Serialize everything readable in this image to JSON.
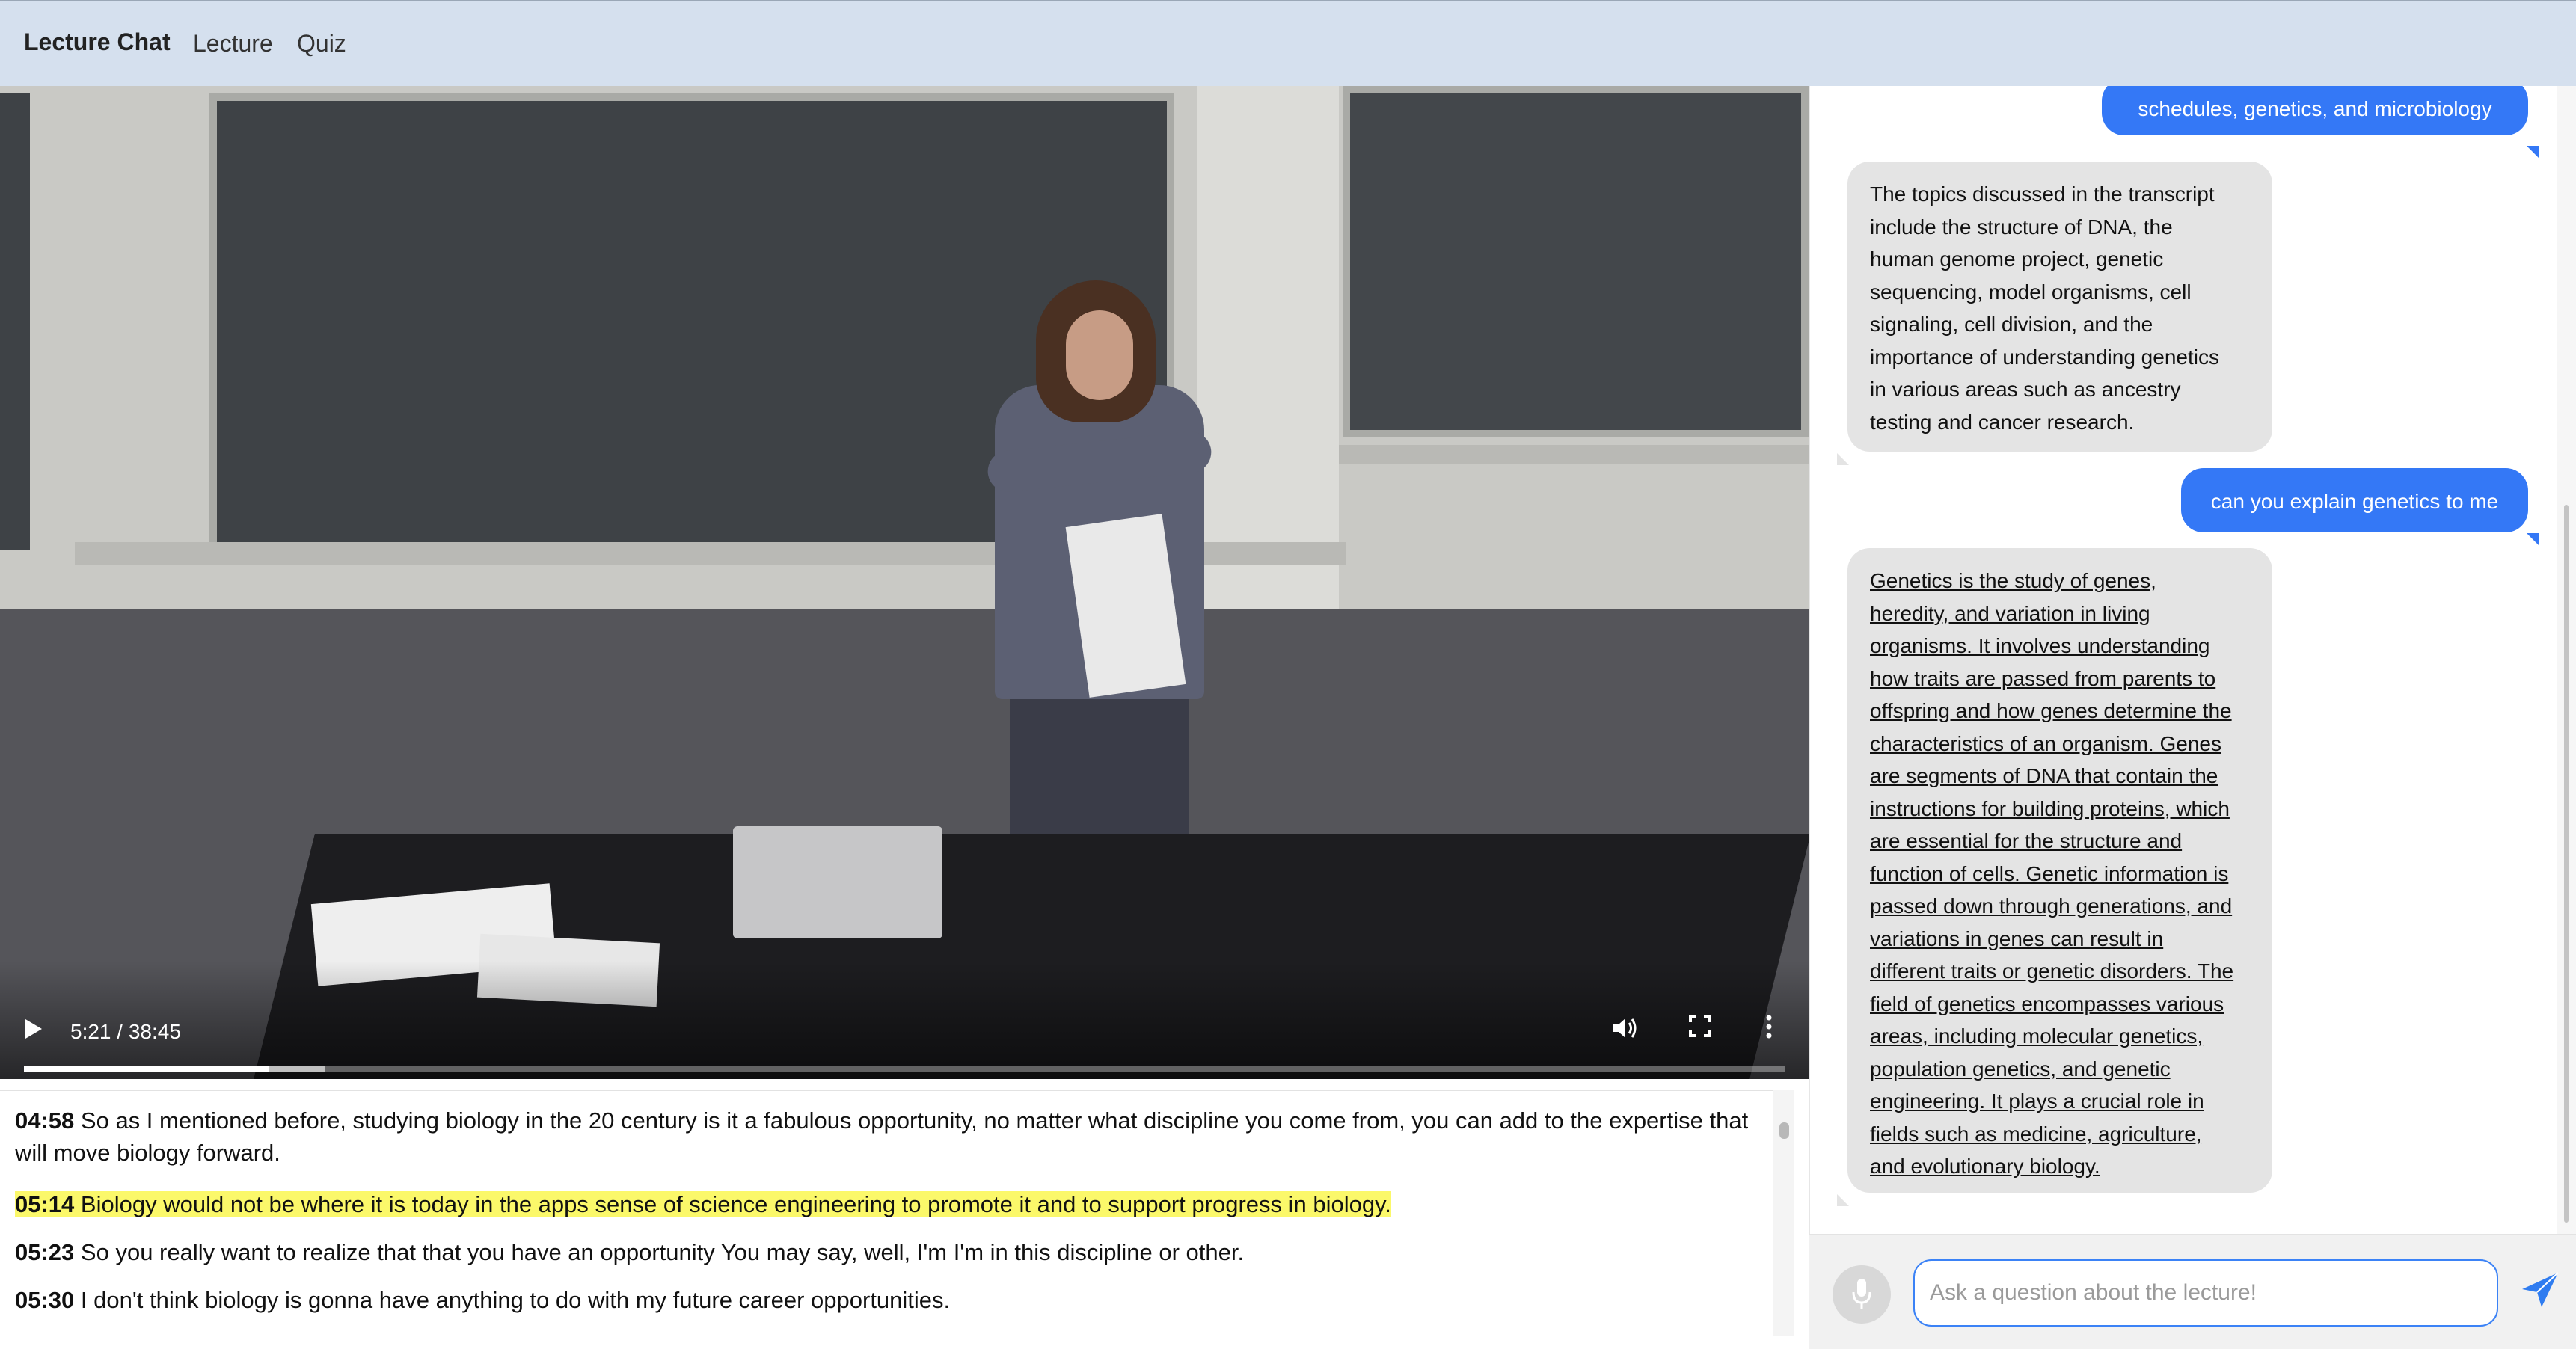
{
  "nav": {
    "brand": "Lecture Chat",
    "links": [
      "Lecture",
      "Quiz"
    ]
  },
  "video": {
    "time_display": "5:21 / 38:45",
    "progress_fraction": 0.139,
    "icons": [
      "play-icon",
      "volume-icon",
      "fullscreen-icon",
      "more-vert-icon"
    ]
  },
  "transcript": {
    "lines": [
      {
        "time": "04:58",
        "text": "So as I mentioned before, studying biology in the 20 century is it a fabulous opportunity, no matter what discipline you come from, you can add to the expertise that will move biology forward.",
        "highlighted": false
      },
      {
        "time": "05:14",
        "text": "Biology would not be where it is today in the apps sense of science engineering to promote it and to support progress in biology.",
        "highlighted": true
      },
      {
        "time": "05:23",
        "text": "So you really want to realize that that you have an opportunity You may say, well, I'm I'm in this discipline or other.",
        "highlighted": false
      },
      {
        "time": "05:30",
        "text": "I don't think biology is gonna have anything to do with my future career opportunities.",
        "highlighted": false
      }
    ]
  },
  "chat": {
    "messages": [
      {
        "role": "user",
        "text": "schedules, genetics, and microbiology"
      },
      {
        "role": "bot",
        "lines": [
          "The topics discussed in the transcript",
          "include the structure of DNA, the",
          "human genome project, genetic",
          "sequencing, model organisms, cell",
          "signaling, cell division, and the",
          "importance of understanding genetics",
          "in various areas such as ancestry",
          "testing and cancer research."
        ]
      },
      {
        "role": "user",
        "text": "can you explain genetics to me"
      },
      {
        "role": "bot",
        "lines": [
          "Genetics is the study of genes,",
          "heredity, and variation in living",
          "organisms. It involves understanding",
          "how traits are passed from parents to",
          "offspring and how genes determine the",
          "characteristics of an organism. Genes",
          "are segments of DNA that contain the",
          "instructions for building proteins, which",
          "are essential for the structure and",
          "function of cells. Genetic information is",
          "passed down through generations, and",
          "variations in genes can result in",
          "different traits or genetic disorders. The",
          "field of genetics encompasses various",
          "areas, including molecular genetics,",
          "population genetics, and genetic",
          "engineering. It plays a crucial role in",
          "fields such as medicine, agriculture,",
          "and evolutionary biology."
        ]
      }
    ],
    "input_placeholder": "Ask a question about the lecture!",
    "input_value": "",
    "icons": [
      "microphone-icon",
      "send-icon"
    ],
    "colors": {
      "user_bubble": "#3478f6",
      "bot_bubble": "#e4e4e4",
      "highlight": "#fbf86a"
    }
  }
}
